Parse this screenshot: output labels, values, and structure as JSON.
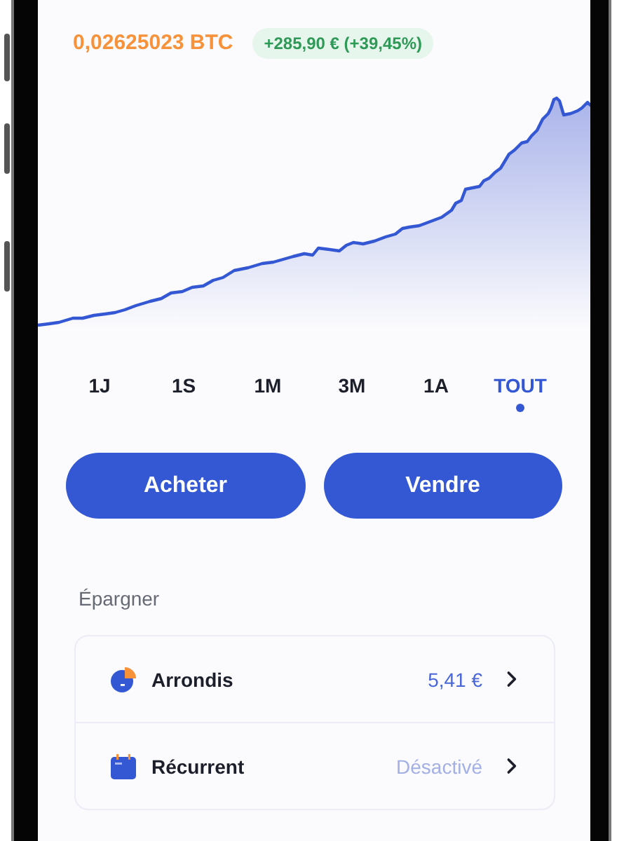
{
  "holding": {
    "amount": "0,02625023 BTC",
    "change": "+285,90 € (+39,45%)"
  },
  "ranges": [
    {
      "label": "1J",
      "selected": false
    },
    {
      "label": "1S",
      "selected": false
    },
    {
      "label": "1M",
      "selected": false
    },
    {
      "label": "3M",
      "selected": false
    },
    {
      "label": "1A",
      "selected": false
    },
    {
      "label": "TOUT",
      "selected": true
    }
  ],
  "actions": [
    "Acheter",
    "Vendre"
  ],
  "savings": {
    "title": "Épargner",
    "rows": [
      {
        "kind": "roundup",
        "label": "Arrondis",
        "value": "5,41 €",
        "enabled": true
      },
      {
        "kind": "recurring",
        "label": "Récurrent",
        "value": "Désactivé",
        "enabled": false
      }
    ]
  }
}
